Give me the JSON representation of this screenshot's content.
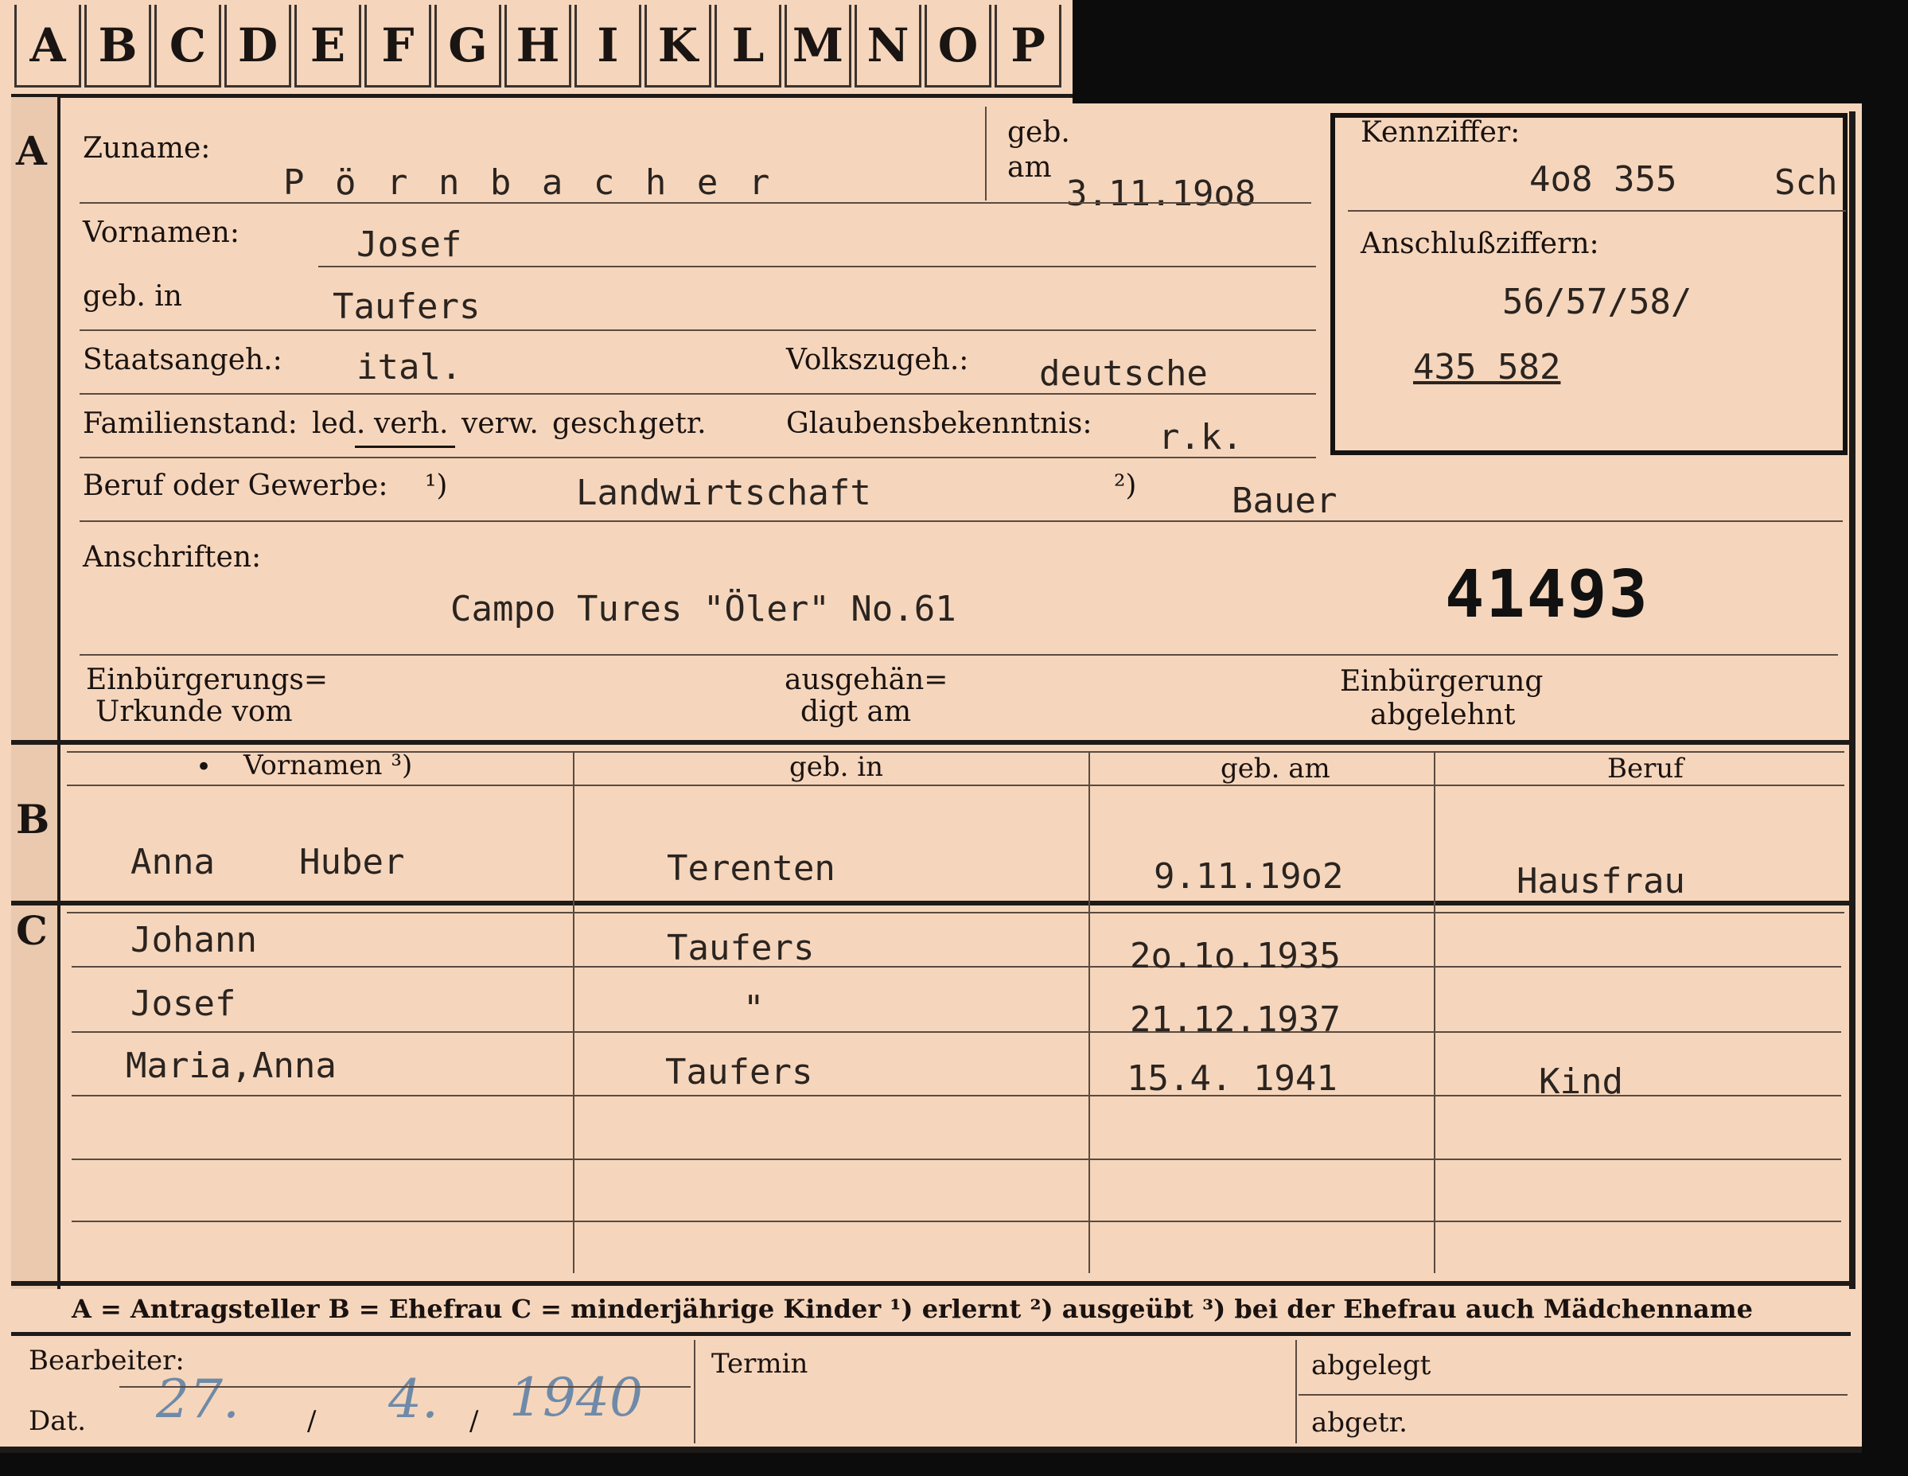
{
  "tabs": [
    "A",
    "B",
    "C",
    "D",
    "E",
    "F",
    "G",
    "H",
    "I",
    "K",
    "L",
    "M",
    "N",
    "O",
    "P"
  ],
  "section_letters": {
    "a": "A",
    "b": "B",
    "c": "C"
  },
  "applicant": {
    "surname_label": "Zuname:",
    "surname": "P ö r n b a c h e r",
    "born_label_1": "geb.",
    "born_label_2": "am",
    "birth_date": "3.11.19o8",
    "first_names_label": "Vornamen:",
    "first_names": "Josef",
    "birthplace_label": "geb. in",
    "birthplace": "Taufers",
    "citizenship_label": "Staatsangeh.:",
    "citizenship": "ital.",
    "ethnicity_label": "Volkszugeh.:",
    "ethnicity": "deutsche",
    "marital_label": "Familienstand:",
    "marital_options": [
      "led.",
      "verh.",
      "verw.",
      "gesch.",
      "getr."
    ],
    "marital_selected": "verh.",
    "religion_label": "Glaubensbekenntnis:",
    "religion": "r.k.",
    "occupation_label": "Beruf oder Gewerbe:",
    "occ_note_1": "¹)",
    "occupation_1": "Landwirtschaft",
    "occ_note_2": "²)",
    "occupation_2": "Bauer",
    "address_label": "Anschriften:",
    "address": "Campo Tures \"Öler\" No.61",
    "stamp_number": "41493",
    "naturalization_cert_label_1": "Einbürgerungs=",
    "naturalization_cert_label_2": "Urkunde vom",
    "handed_label_1": "ausgehän=",
    "handed_label_2": "digt am",
    "naturalization_status_1": "Einbürgerung",
    "naturalization_status_2": "abgelehnt"
  },
  "kennziffer": {
    "label": "Kennziffer:",
    "value": "4o8 355",
    "suffix": "Sch",
    "connection_label": "Anschlußziffern:",
    "connection_1": "56/57/58/",
    "connection_2": "435 582"
  },
  "wife": {
    "headers": [
      "Vornamen ³)",
      "geb. in",
      "geb. am",
      "Beruf"
    ],
    "bullet": "•",
    "first_name": "Anna",
    "maiden_name": "Huber",
    "birthplace": "Terenten",
    "birth_date": "9.11.19o2",
    "occupation": "Hausfrau"
  },
  "children": [
    {
      "name": "Johann",
      "birthplace": "Taufers",
      "birth_date": "2o.1o.1935",
      "occupation": ""
    },
    {
      "name": "Josef",
      "birthplace": "\"",
      "birth_date": "21.12.1937",
      "occupation": ""
    },
    {
      "name": "Maria,Anna",
      "birthplace": "Taufers",
      "birth_date": "15.4. 1941",
      "occupation": "Kind"
    }
  ],
  "legend": "A = Antragsteller   B = Ehefrau   C = minderjährige Kinder   ¹) erlernt   ²) ausgeübt   ³) bei der Ehefrau auch Mädchenname",
  "footer": {
    "processor_label": "Bearbeiter:",
    "date_label": "Dat.",
    "date_day": "27.",
    "date_month": "4.",
    "date_year": "1940",
    "slash": "/",
    "termin_label": "Termin",
    "filed_label": "abgelegt",
    "sent_label": "abgetr."
  },
  "colors": {
    "card": "#f5d6bc",
    "ink": "#1a1512",
    "handwriting": "#6f8aa8",
    "frame": "#1e1a18"
  }
}
